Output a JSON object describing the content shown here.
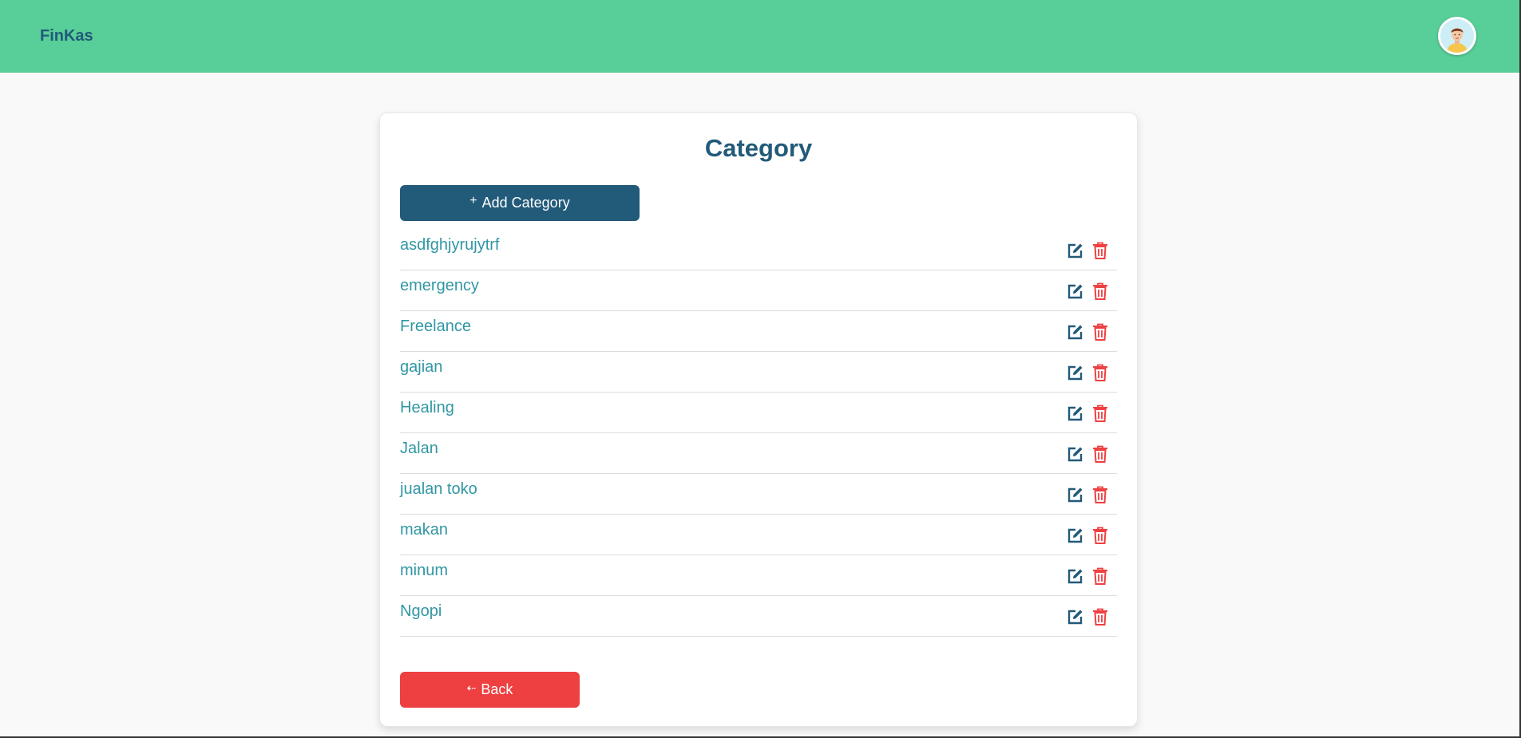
{
  "app": {
    "brand": "FinKas"
  },
  "user": {
    "avatar_icon": "avatar-icon"
  },
  "page": {
    "title": "Category"
  },
  "actions": {
    "add_label": "Add Category",
    "add_icon": "plus-icon",
    "back_label": "Back",
    "back_icon": "arrow-left-icon"
  },
  "categories": [
    {
      "label": "asdfghjyrujytrf"
    },
    {
      "label": "emergency"
    },
    {
      "label": "Freelance"
    },
    {
      "label": "gajian"
    },
    {
      "label": "Healing"
    },
    {
      "label": "Jalan"
    },
    {
      "label": "jualan toko"
    },
    {
      "label": "makan"
    },
    {
      "label": "minum"
    },
    {
      "label": "Ngopi"
    }
  ],
  "row_actions": {
    "edit_icon": "edit-icon",
    "delete_icon": "trash-icon"
  },
  "colors": {
    "header": "#58ce98",
    "primary": "#225a7a",
    "danger": "#ee4041",
    "category_text": "#3197a3"
  }
}
